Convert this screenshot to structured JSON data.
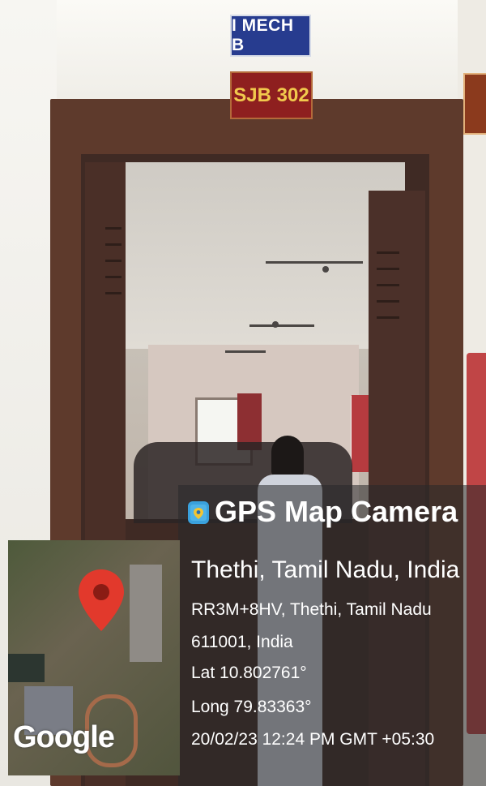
{
  "signs": {
    "class_label": "I MECH B",
    "room_label": "SJB 302"
  },
  "overlay": {
    "app_title": "GPS Map Camera",
    "location_title": "Thethi, Tamil Nadu, India",
    "address_line1": "RR3M+8HV, Thethi, Tamil Nadu",
    "address_line2": "611001, India",
    "latitude": "Lat 10.802761°",
    "longitude": "Long 79.83363°",
    "datetime": "20/02/23 12:24 PM GMT +05:30",
    "map_logo": "Google",
    "icons": [
      "map-pin-icon",
      "gps-map-camera-app-icon"
    ],
    "pin_color": "#e2392c"
  }
}
